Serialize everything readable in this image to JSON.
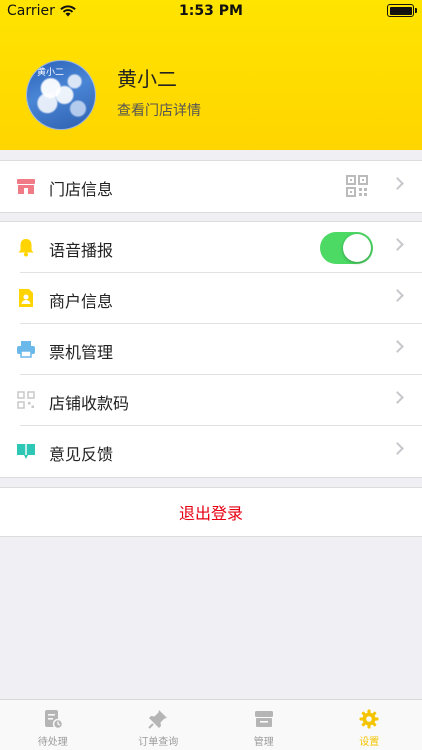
{
  "status_bar": {
    "carrier": "Carrier",
    "time": "1:53 PM"
  },
  "profile": {
    "avatar_text": "黄小二",
    "name": "黄小二",
    "subtitle": "查看门店详情"
  },
  "group1": [
    {
      "label": "门店信息",
      "icon": "store-icon"
    }
  ],
  "group2": [
    {
      "label": "语音播报",
      "icon": "bell-icon",
      "toggle_on": true
    },
    {
      "label": "商户信息",
      "icon": "merchant-icon"
    },
    {
      "label": "票机管理",
      "icon": "printer-icon"
    },
    {
      "label": "店铺收款码",
      "icon": "qr-code-icon"
    },
    {
      "label": "意见反馈",
      "icon": "feedback-icon"
    }
  ],
  "logout_label": "退出登录",
  "tabbar": [
    {
      "label": "待处理",
      "icon": "pending-icon",
      "active": false
    },
    {
      "label": "订单查询",
      "icon": "pin-icon",
      "active": false
    },
    {
      "label": "管理",
      "icon": "manage-icon",
      "active": false
    },
    {
      "label": "设置",
      "icon": "gear-icon",
      "active": true
    }
  ],
  "colors": {
    "header": "#ffdd00",
    "accent": "#f5c400",
    "toggle": "#4cd964",
    "logout": "#e60012"
  }
}
